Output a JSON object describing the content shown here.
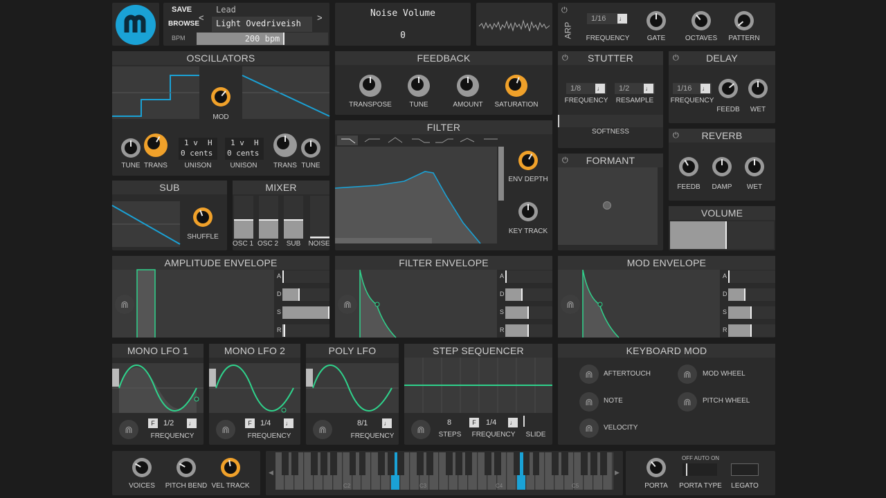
{
  "colors": {
    "accent": "#f0a12a",
    "wave": "#1aa2d6",
    "lfo": "#2fd38c",
    "bg": "#1c1c1c"
  },
  "header": {
    "logo": "helm-logo-icon",
    "save": "SAVE",
    "browse": "BROWSE",
    "bpm_label": "BPM",
    "bpm_value": "200 bpm",
    "preset_category": "Lead",
    "preset_name": "Light Ovedriveish",
    "prev": "<",
    "next": ">",
    "param_name": "Noise Volume",
    "param_value": "0"
  },
  "arp": {
    "title": "ARP",
    "frequency_value": "1/16",
    "labels": [
      "FREQUENCY",
      "GATE",
      "OCTAVES",
      "PATTERN"
    ]
  },
  "oscillators": {
    "title": "OSCILLATORS",
    "mod_label": "MOD",
    "knob_labels": [
      "TUNE",
      "TRANS",
      "UNISON",
      "UNISON",
      "TRANS",
      "TUNE"
    ],
    "unison_voices": "1 v",
    "unison_h": "H",
    "unison_cents": "0 cents"
  },
  "feedback": {
    "title": "FEEDBACK",
    "labels": [
      "TRANSPOSE",
      "TUNE",
      "AMOUNT",
      "SATURATION"
    ]
  },
  "stutter": {
    "title": "STUTTER",
    "freq_value": "1/8",
    "resample_value": "1/2",
    "labels": [
      "FREQUENCY",
      "RESAMPLE"
    ],
    "softness": "SOFTNESS"
  },
  "delay": {
    "title": "DELAY",
    "freq_value": "1/16",
    "labels": [
      "FREQUENCY",
      "FEEDB",
      "WET"
    ]
  },
  "reverb": {
    "title": "REVERB",
    "labels": [
      "FEEDB",
      "DAMP",
      "WET"
    ]
  },
  "formant": {
    "title": "FORMANT"
  },
  "volume": {
    "title": "VOLUME"
  },
  "filter": {
    "title": "FILTER",
    "labels": [
      "ENV DEPTH",
      "KEY TRACK"
    ]
  },
  "sub": {
    "title": "SUB",
    "shuffle": "SHUFFLE"
  },
  "mixer": {
    "title": "MIXER",
    "labels": [
      "OSC 1",
      "OSC 2",
      "SUB",
      "NOISE"
    ],
    "levels": [
      0.5,
      0.5,
      0.5,
      0.05
    ]
  },
  "envelopes": {
    "amp": "AMPLITUDE ENVELOPE",
    "filter": "FILTER ENVELOPE",
    "mod": "MOD ENVELOPE",
    "adsr": [
      "A",
      "D",
      "S",
      "R"
    ]
  },
  "lfo1": {
    "title": "MONO LFO 1",
    "rate": "1/2",
    "label": "FREQUENCY",
    "f": "F"
  },
  "lfo2": {
    "title": "MONO LFO 2",
    "rate": "1/4",
    "label": "FREQUENCY",
    "f": "F"
  },
  "polylfo": {
    "title": "POLY LFO",
    "rate": "8/1",
    "label": "FREQUENCY"
  },
  "step": {
    "title": "STEP SEQUENCER",
    "steps_value": "8",
    "rate": "1/4",
    "f": "F",
    "labels": [
      "STEPS",
      "FREQUENCY",
      "SLIDE"
    ]
  },
  "keymod": {
    "title": "KEYBOARD MOD",
    "items": [
      "AFTERTOUCH",
      "MOD WHEEL",
      "NOTE",
      "PITCH WHEEL",
      "VELOCITY"
    ]
  },
  "bottom": {
    "labels": [
      "VOICES",
      "PITCH BEND",
      "VEL TRACK"
    ],
    "porta": "PORTA",
    "porta_type": "PORTA TYPE",
    "legato": "LEGATO",
    "porta_opts": "OFF AUTO ON",
    "octaves": [
      "C2",
      "C3",
      "C4",
      "C5"
    ]
  }
}
